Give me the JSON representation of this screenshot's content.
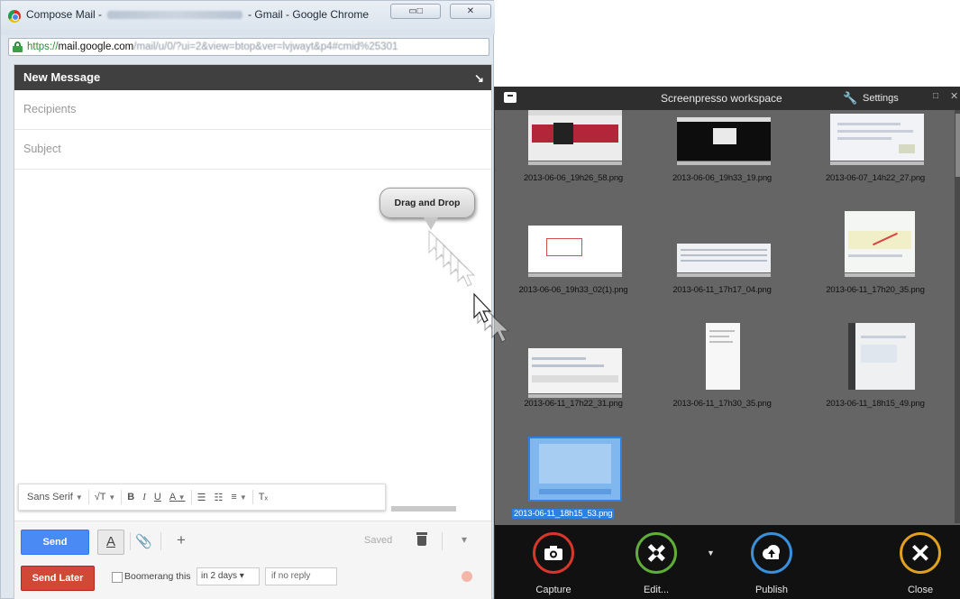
{
  "chrome": {
    "title_prefix": "Compose Mail -",
    "title_suffix": "- Gmail - Google Chrome",
    "url_https": "https://",
    "url_host": "mail.google.com",
    "url_path": "/mail/u/0/?ui=2&view=btop&ver=lvjwayt&p4#cmid%25301"
  },
  "compose": {
    "header_title": "New Message",
    "recipients_placeholder": "Recipients",
    "subject_placeholder": "Subject",
    "format_toolbar": {
      "font": "Sans Serif",
      "size": "√T",
      "bold": "B",
      "italic": "I",
      "underline": "U",
      "text_color": "A",
      "numbered_list": "☰",
      "bulleted_list": "☷",
      "align": "≡",
      "remove_format": "Tₓ"
    },
    "send_label": "Send",
    "format_toggle": "A",
    "saved_label": "Saved",
    "send_later_label": "Send Later",
    "boomerang_label": "Boomerang this",
    "boomerang_delay": "in 2 days",
    "boomerang_condition": "if no reply"
  },
  "overlay": {
    "tooltip": "Drag and Drop"
  },
  "screenpresso": {
    "title": "Screenpresso workspace",
    "settings_label": "Settings",
    "files": [
      "2013-06-06_19h26_58.png",
      "2013-06-06_19h33_19.png",
      "2013-06-07_14h22_27.png",
      "2013-06-06_19h33_02(1).png",
      "2013-06-11_17h17_04.png",
      "2013-06-11_17h20_35.png",
      "2013-06-11_17h22_31.png",
      "2013-06-11_17h30_35.png",
      "2013-06-11_18h15_49.png",
      "2013-06-11_18h15_53.png"
    ],
    "actions": {
      "capture": "Capture",
      "edit": "Edit...",
      "publish": "Publish",
      "close": "Close"
    },
    "colors": {
      "capture": "#d6362b",
      "edit": "#5fae3c",
      "publish": "#3a8fd8",
      "close": "#e0a020"
    }
  }
}
